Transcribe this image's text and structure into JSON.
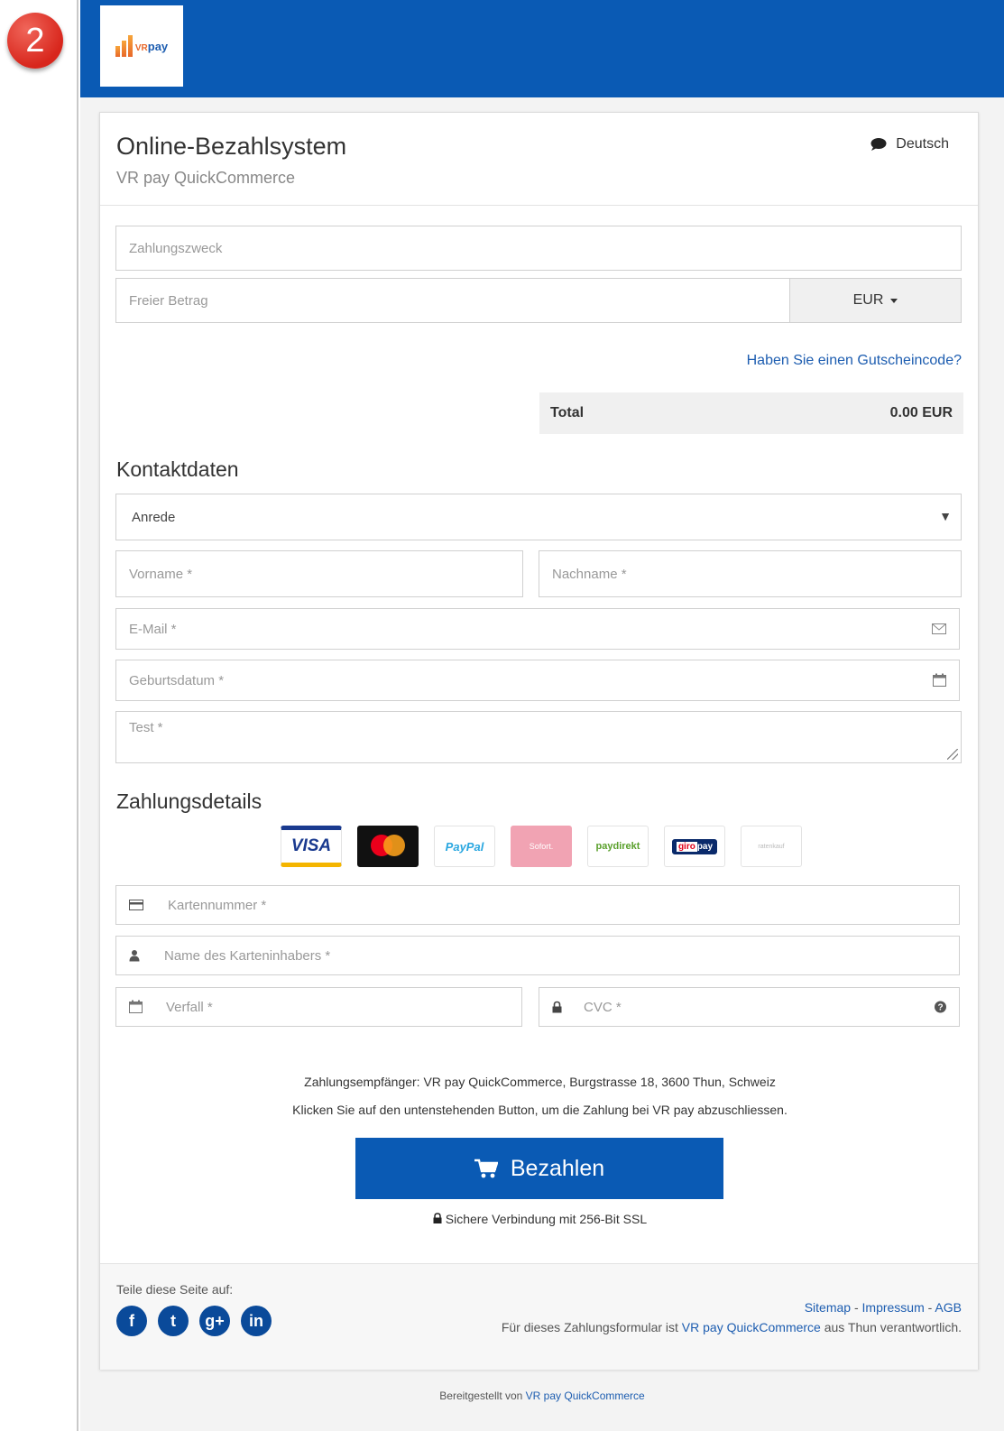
{
  "step_badge": "2",
  "logo": {
    "vr": "VR",
    "pay": "pay"
  },
  "header": {
    "title": "Online-Bezahlsystem",
    "subtitle": "VR pay QuickCommerce",
    "language": "Deutsch"
  },
  "form": {
    "purpose_placeholder": "Zahlungszweck",
    "amount_placeholder": "Freier Betrag",
    "currency": "EUR",
    "voucher_link": "Haben Sie einen Gutscheincode?",
    "total_label": "Total",
    "total_value": "0.00 EUR"
  },
  "contact": {
    "heading": "Kontaktdaten",
    "salutation": "Anrede",
    "firstname_placeholder": "Vorname *",
    "lastname_placeholder": "Nachname *",
    "email_placeholder": "E-Mail *",
    "birthdate_placeholder": "Geburtsdatum *",
    "test_placeholder": "Test *"
  },
  "payment": {
    "heading": "Zahlungsdetails",
    "methods": [
      "VISA",
      "mastercard",
      "PayPal",
      "Sofort.",
      "paydirekt",
      "giropay",
      "ratenkauf"
    ],
    "card_number_placeholder": "Kartennummer *",
    "card_holder_placeholder": "Name des Karteninhabers *",
    "expiry_placeholder": "Verfall *",
    "cvc_placeholder": "CVC *"
  },
  "info": {
    "recipient": "Zahlungsempfänger: VR pay QuickCommerce, Burgstrasse 18, 3600 Thun, Schweiz",
    "instruction": "Klicken Sie auf den untenstehenden Button, um die Zahlung bei VR pay abzuschliessen.",
    "pay_button": "Bezahlen",
    "ssl": "Sichere Verbindung mit 256-Bit SSL"
  },
  "footer": {
    "share_label": "Teile diese Seite auf:",
    "socials": [
      "f",
      "t",
      "g+",
      "in"
    ],
    "links": [
      "Sitemap",
      "Impressum",
      "AGB"
    ],
    "link_sep": " - ",
    "resp_prefix": "Für dieses Zahlungsformular ist ",
    "resp_link": "VR pay QuickCommerce",
    "resp_suffix": " aus Thun verantwortlich.",
    "by_prefix": "Bereitgestellt von ",
    "by_link": "VR pay QuickCommerce"
  },
  "colors": {
    "brand": "#0a5ab4",
    "link": "#1d5db0",
    "badge": "#d8261c"
  }
}
